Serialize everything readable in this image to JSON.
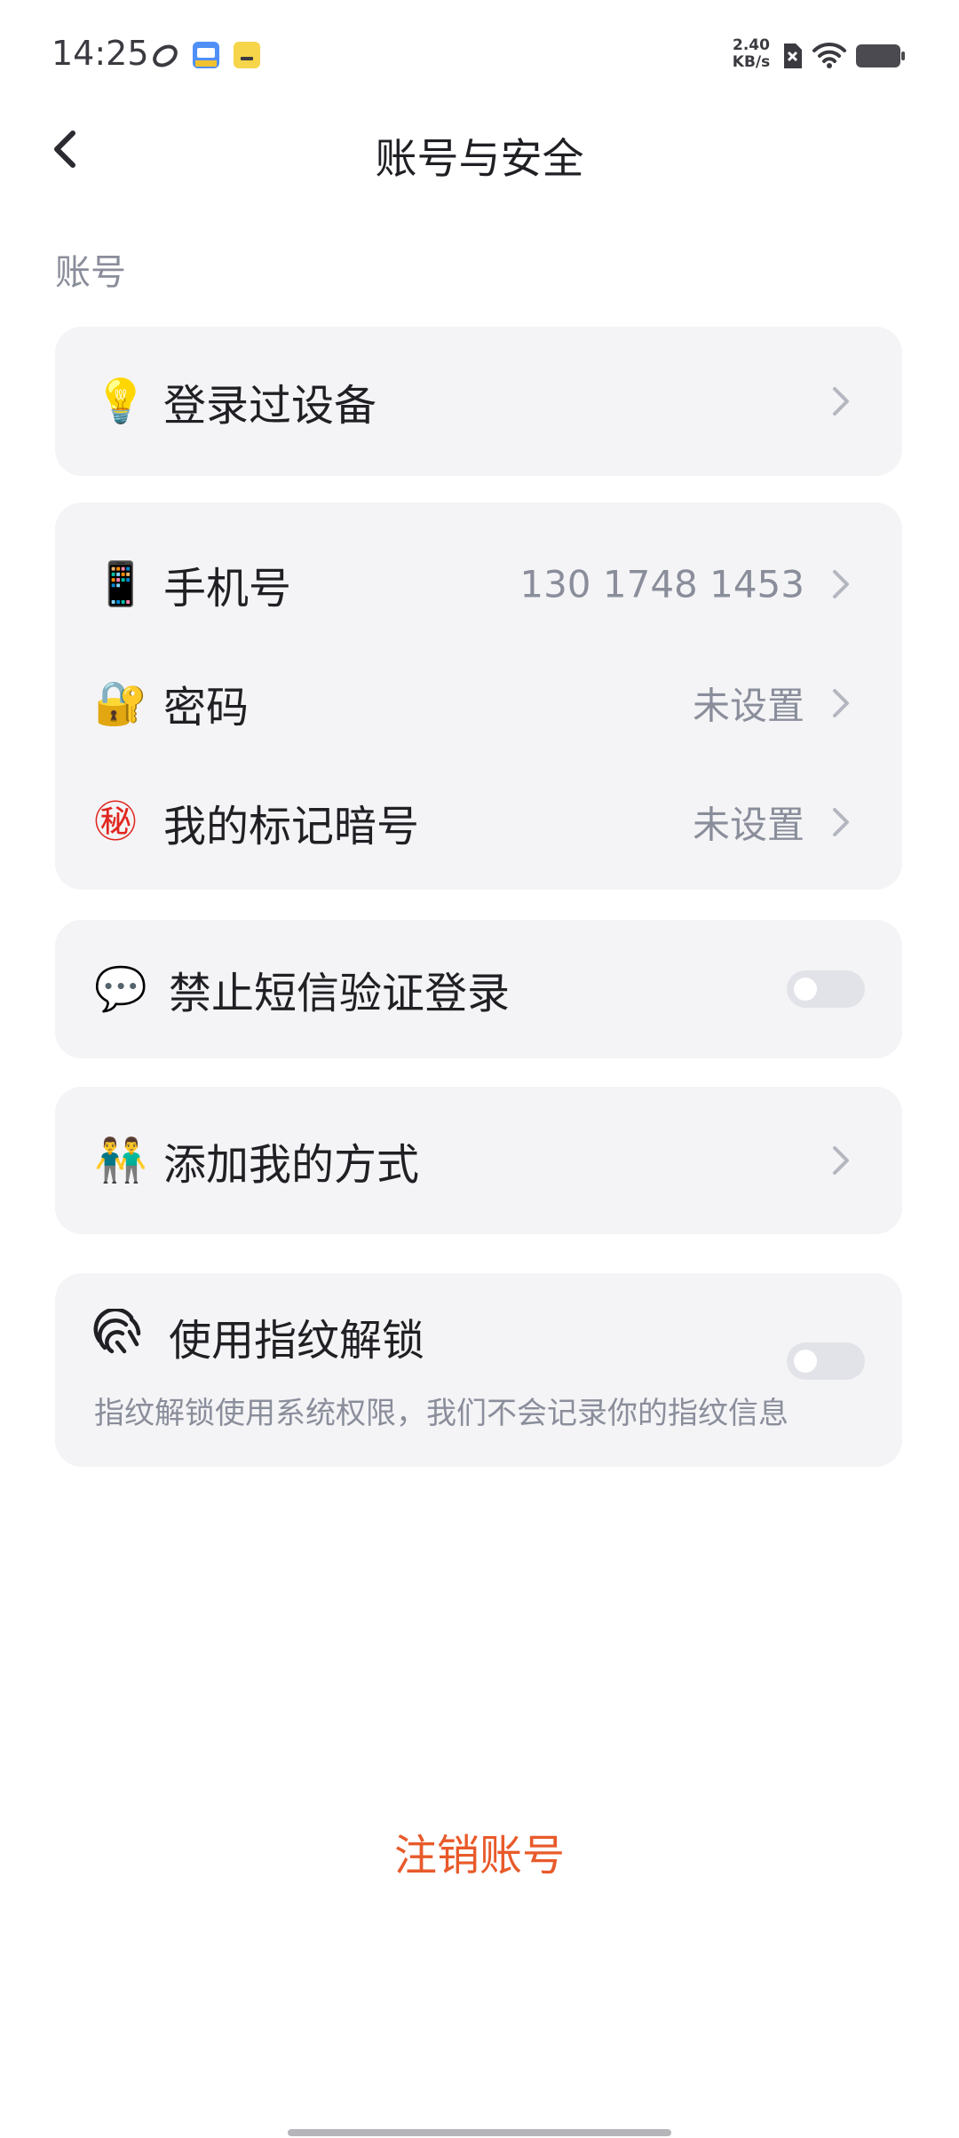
{
  "status_bar": {
    "time": "14:25",
    "net_speed": "2.40",
    "net_unit": "KB/s",
    "icons": [
      "sync-icon",
      "app-notification-icon",
      "app-notification-icon",
      "no-sim-icon",
      "wifi-icon",
      "battery-icon"
    ]
  },
  "header": {
    "title": "账号与安全",
    "back_icon": "chevron-left-icon"
  },
  "section": {
    "account_label": "账号"
  },
  "rows": {
    "devices": {
      "emoji": "💡",
      "label": "登录过设备"
    },
    "phone": {
      "emoji": "📱",
      "label": "手机号",
      "value": "130 1748 1453"
    },
    "password": {
      "emoji": "🔐",
      "label": "密码",
      "value": "未设置"
    },
    "secret_code": {
      "emoji": "㊙",
      "label": "我的标记暗号",
      "value": "未设置"
    },
    "sms_block": {
      "emoji": "💬",
      "label": "禁止短信验证登录",
      "enabled": false
    },
    "add_me": {
      "emoji": "👬",
      "label": "添加我的方式"
    },
    "fingerprint": {
      "icon": "fingerprint-icon",
      "label": "使用指纹解锁",
      "desc": "指纹解锁使用系统权限，我们不会记录你的指纹信息",
      "enabled": false
    }
  },
  "logout": {
    "label": "注销账号"
  },
  "colors": {
    "card_bg": "#f4f4f6",
    "text_primary": "#1f1f24",
    "text_secondary": "#8a8e9b",
    "danger": "#e85a2a",
    "toggle_off": "#e2e3e8"
  }
}
